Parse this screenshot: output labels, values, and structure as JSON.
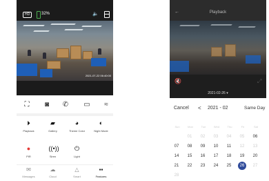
{
  "left": {
    "status": {
      "hd": "HD",
      "battery": "32%"
    },
    "timestamp": "2021-07-22 06:40:00",
    "features": [
      {
        "label": "Playback",
        "icon": "play-icon"
      },
      {
        "label": "Gallery",
        "icon": "gallery-icon"
      },
      {
        "label": "Theme Color",
        "icon": "palette-icon"
      },
      {
        "label": "Night Mode",
        "icon": "night-mode-icon"
      },
      {
        "label": "PIR",
        "icon": "pir-icon"
      },
      {
        "label": "Siren",
        "icon": "siren-icon"
      },
      {
        "label": "Light",
        "icon": "light-icon"
      }
    ],
    "tabs": [
      {
        "label": "Messages",
        "icon": "messages-icon"
      },
      {
        "label": "Cloud",
        "icon": "cloud-icon"
      },
      {
        "label": "Smart",
        "icon": "smart-icon"
      },
      {
        "label": "Features",
        "icon": "features-icon",
        "active": true
      }
    ]
  },
  "right": {
    "title": "Playback",
    "date_bar": "2021-02-26 ▾",
    "calendar": {
      "cancel": "Cancel",
      "prev": "<",
      "month": "2021 - 02",
      "same_day": "Same Day",
      "weekdays": [
        "Sun",
        "Mon",
        "Tue",
        "Wed",
        "Thu",
        "Fri",
        "Sat"
      ],
      "weeks": [
        [
          "",
          "01",
          "02",
          "03",
          "04",
          "05",
          "06"
        ],
        [
          "07",
          "08",
          "09",
          "10",
          "11",
          "12",
          "13"
        ],
        [
          "14",
          "15",
          "16",
          "17",
          "18",
          "19",
          "20"
        ],
        [
          "21",
          "22",
          "23",
          "24",
          "25",
          "26",
          "27"
        ],
        [
          "28",
          "",
          "",
          "",
          "",
          "",
          ""
        ]
      ],
      "selected": "26"
    }
  }
}
